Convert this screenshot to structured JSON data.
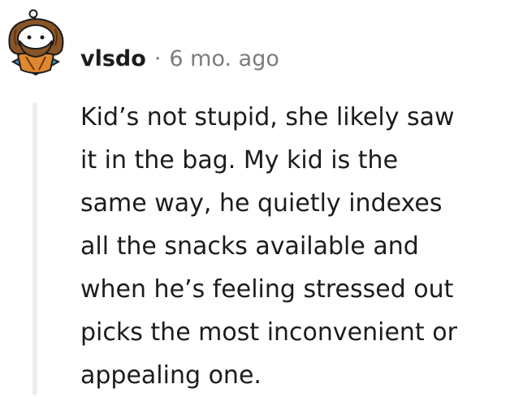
{
  "comment": {
    "author": "vlsdo",
    "separator": "·",
    "timestamp": "6 mo. ago",
    "avatar_icon": "snoo-avatar-icon",
    "body": "Kid’s not stupid, she likely saw\nit in the bag. My kid is the\nsame way, he quietly indexes\nall the snacks available and\nwhen he’s feeling stressed out\npicks the most inconvenient or\nappealing one."
  },
  "colors": {
    "text": "#1c1c1c",
    "meta": "#7c7c7c",
    "thread_line": "#eaedef"
  }
}
